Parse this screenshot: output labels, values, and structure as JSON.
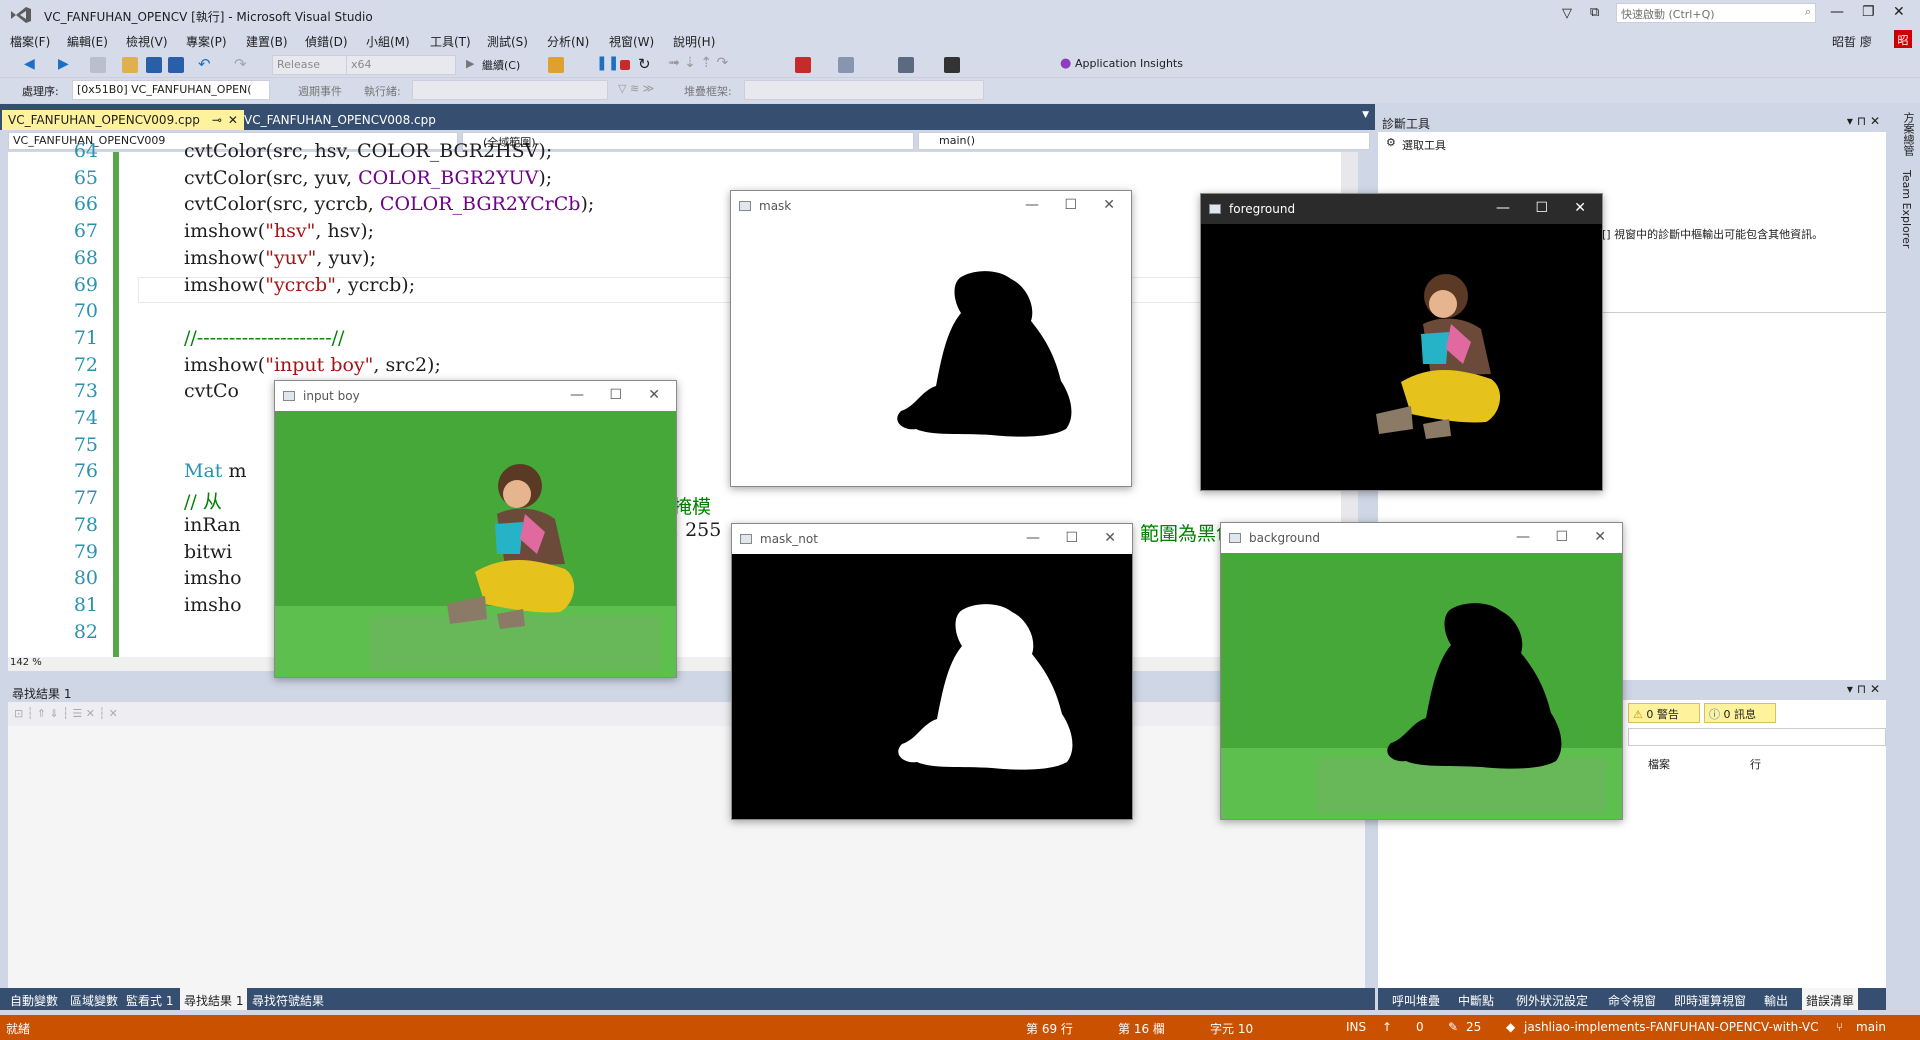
{
  "window": {
    "title": "VC_FANFUHAN_OPENCV [執行] - Microsoft Visual Studio",
    "quick_launch_placeholder": "快速啟動 (Ctrl+Q)",
    "user": "昭晢 廖",
    "user_initial": "昭"
  },
  "menu": [
    "檔案(F)",
    "編輯(E)",
    "檢視(V)",
    "專案(P)",
    "建置(B)",
    "偵錯(D)",
    "小組(M)",
    "工具(T)",
    "測試(S)",
    "分析(N)",
    "視窗(W)",
    "說明(H)"
  ],
  "toolbar": {
    "config": "Release",
    "platform": "x64",
    "continue_label": "繼續(C)",
    "app_insights": "Application Insights"
  },
  "toolbar2": {
    "process_label": "處理序:",
    "process_value": "[0x51B0] VC_FANFUHAN_OPEN(",
    "lifecycle_label": "週期事件",
    "thread_label": "執行緒:",
    "stack_label": "堆疊框架:"
  },
  "editor": {
    "tabs": [
      {
        "label": "VC_FANFUHAN_OPENCV009.cpp",
        "active": true
      },
      {
        "label": "VC_FANFUHAN_OPENCV008.cpp",
        "active": false
      }
    ],
    "nav_project": "VC_FANFUHAN_OPENCV009",
    "nav_scope": "(全域範圍)",
    "nav_function": "main()",
    "zoom": "142 %",
    "lines": [
      {
        "num": "64",
        "html": "cvtColor(src, hsv, COLOR_BGR2HSV);"
      },
      {
        "num": "65",
        "html": "cvtColor(src, yuv, <span class='mac'>COLOR_BGR2YUV</span>);"
      },
      {
        "num": "66",
        "html": "cvtColor(src, ycrcb, <span class='mac'>COLOR_BGR2YCrCb</span>);"
      },
      {
        "num": "67",
        "html": "imshow(<span class='str'>\"hsv\"</span>, hsv);"
      },
      {
        "num": "68",
        "html": "imshow(<span class='str'>\"yuv\"</span>, yuv);"
      },
      {
        "num": "69",
        "html": "imshow(<span class='str'>\"ycrcb\"</span>, ycrcb);"
      },
      {
        "num": "70",
        "html": ""
      },
      {
        "num": "71",
        "html": "<span class='cmt'>//---------------------//</span>"
      },
      {
        "num": "72",
        "html": "imshow(<span class='str'>\"input boy\"</span>, src2);"
      },
      {
        "num": "73",
        "html": "cvtCo"
      },
      {
        "num": "74",
        "html": ""
      },
      {
        "num": "75",
        "html": ""
      },
      {
        "num": "76",
        "html": "<span style='color:#2b91af'>Mat</span> m"
      },
      {
        "num": "77",
        "html": "<span class='cmt'>// 从</span>"
      },
      {
        "num": "78",
        "html": "inRan"
      },
      {
        "num": "79",
        "html": "bitwi"
      },
      {
        "num": "80",
        "html": "imsho"
      },
      {
        "num": "81",
        "html": "imsho"
      },
      {
        "num": "82",
        "html": ""
      }
    ],
    "peek_text_1": "掩模",
    "peek_text_2": ", 255",
    "peek_text_3": "範圍為黑色"
  },
  "find_panel": {
    "title": "尋找結果 1"
  },
  "bottom_tabs": [
    "自動變數",
    "區域變數",
    "監看式 1",
    "尋找結果 1",
    "尋找符號結果"
  ],
  "bottom_tabs_active": 3,
  "diagnostics": {
    "title": "診斷工具",
    "select_tools": "選取工具",
    "message": "[] 視窗中的診斷中樞輸出可能包含其他資訊。"
  },
  "error_list": {
    "warnings": "0 警告",
    "messages": "0 訊息",
    "col_file": "檔案",
    "col_line": "行"
  },
  "right_tabs": [
    "呼叫堆疊",
    "中斷點",
    "例外狀況設定",
    "命令視窗",
    "即時運算視窗",
    "輸出",
    "錯誤清單"
  ],
  "right_tabs_active": 6,
  "sidebar": [
    "方案總管",
    "Team Explorer"
  ],
  "status": {
    "ready": "就緒",
    "line": "第 69 行",
    "col": "第 16 欄",
    "char": "字元 10",
    "ins": "INS",
    "up": "0",
    "edits": "25",
    "repo": "jashliao-implements-FANFUHAN-OPENCV-with-VC",
    "branch": "main"
  },
  "cv_windows": [
    {
      "title": "mask",
      "dark": false
    },
    {
      "title": "foreground",
      "dark": true
    },
    {
      "title": "input boy",
      "dark": false
    },
    {
      "title": "mask_not",
      "dark": false
    },
    {
      "title": "background",
      "dark": false
    }
  ],
  "colors": {
    "accent": "#ca5100",
    "tab_active": "#fff29d",
    "line_number": "#2b91af",
    "green_screen": "#4caf3f"
  }
}
